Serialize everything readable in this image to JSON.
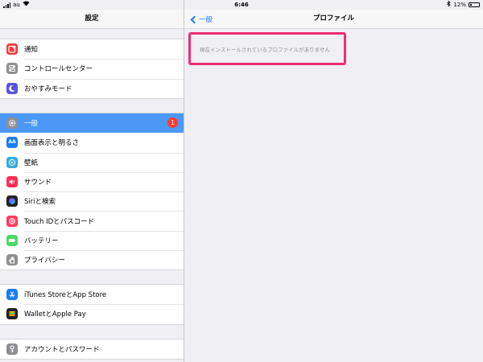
{
  "status_bar": {
    "carrier": "au",
    "time": "6:46",
    "battery_percent": "12%"
  },
  "left_pane": {
    "title": "設定",
    "groups": [
      [
        {
          "label": "通知",
          "icon": "notification-icon",
          "color": "#f23c3c"
        },
        {
          "label": "コントロールセンター",
          "icon": "control-center-icon",
          "color": "#8e8e93"
        },
        {
          "label": "おやすみモード",
          "icon": "moon-icon",
          "color": "#5856d6"
        }
      ],
      [
        {
          "label": "一般",
          "icon": "gear-icon",
          "color": "#8e8e93",
          "selected": true,
          "badge": "1"
        },
        {
          "label": "画面表示と明るさ",
          "icon": "display-icon",
          "color": "#1c7cf6"
        },
        {
          "label": "壁紙",
          "icon": "wallpaper-icon",
          "color": "#34aadc"
        },
        {
          "label": "サウンド",
          "icon": "speaker-icon",
          "color": "#ff2d55"
        },
        {
          "label": "Siriと検索",
          "icon": "siri-icon",
          "color": "#222222"
        },
        {
          "label": "Touch IDとパスコード",
          "icon": "fingerprint-icon",
          "color": "#ff3b5c"
        },
        {
          "label": "バッテリー",
          "icon": "battery-icon",
          "color": "#4cd964"
        },
        {
          "label": "プライバシー",
          "icon": "hand-icon",
          "color": "#8e8e93"
        }
      ],
      [
        {
          "label": "iTunes StoreとApp Store",
          "icon": "app-store-icon",
          "color": "#1c7cf6"
        },
        {
          "label": "WalletとApple Pay",
          "icon": "wallet-icon",
          "color": "#1f1f1f"
        }
      ],
      [
        {
          "label": "アカウントとパスワード",
          "icon": "key-icon",
          "color": "#8e8e93"
        }
      ]
    ]
  },
  "right_pane": {
    "back_label": "一般",
    "title": "プロファイル",
    "empty_message": "現在インストールされているプロファイルがありません"
  }
}
